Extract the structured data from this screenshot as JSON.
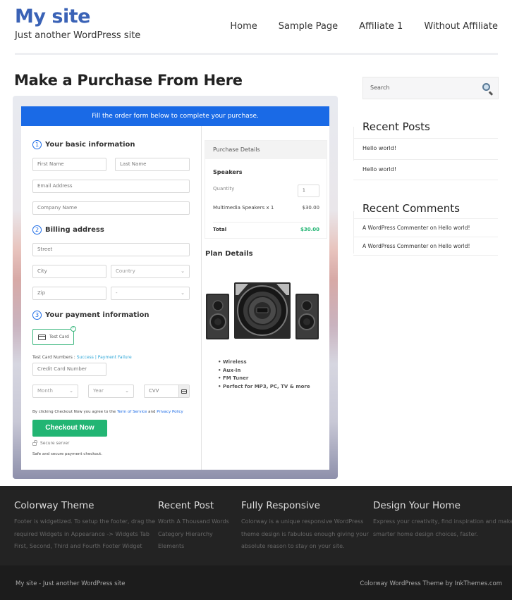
{
  "header": {
    "site_title": "My site",
    "tagline": "Just another WordPress site",
    "nav": [
      "Home",
      "Sample Page",
      "Affiliate 1",
      "Without Affiliate"
    ]
  },
  "page_title": "Make a Purchase From Here",
  "order_form": {
    "banner": "Fill the order form below to complete your purchase.",
    "step1": {
      "number": "1",
      "title": "Your basic information"
    },
    "first_name_placeholder": "First Name",
    "last_name_placeholder": "Last Name",
    "email_placeholder": "Email Address",
    "company_placeholder": "Company Name",
    "step2": {
      "number": "2",
      "title": "Billing address"
    },
    "street_placeholder": "Street",
    "city_placeholder": "City",
    "country_select": "Country",
    "zip_placeholder": "Zip",
    "state_select": "-",
    "step3": {
      "number": "3",
      "title": "Your payment information"
    },
    "payment_method": "Test Card",
    "test_numbers_label": "Test Card Numbers :",
    "test_success": "Success",
    "test_separator": "|",
    "test_failure": "Payment Failure",
    "card_number_placeholder": "Credit Card Number",
    "month_select": "Month",
    "year_select": "Year",
    "cvv_placeholder": "CVV",
    "agree_prefix": "By clicking Checkout Now you agree to the",
    "terms_link": "Term of Service",
    "agree_and": "and",
    "privacy_link": "Privacy Policy",
    "checkout_button": "Checkout Now",
    "secure_label": "Secure server",
    "safe_label": "Safe and secure payment checkout."
  },
  "purchase_details": {
    "heading": "Purchase Details",
    "product": "Speakers",
    "quantity_label": "Quantity",
    "quantity_value": "1",
    "line_item": "Multimedia Speakers x 1",
    "line_price": "$30.00",
    "total_label": "Total",
    "total_value": "$30.00",
    "accent_color": "#22b573"
  },
  "plan_details": {
    "heading": "Plan Details",
    "image": "speakers-image",
    "features": [
      "Wireless",
      "Aux-In",
      "FM Tuner",
      "Perfect for MP3, PC, TV & more"
    ]
  },
  "sidebar": {
    "search_placeholder": "Search",
    "recent_posts_heading": "Recent Posts",
    "recent_posts": [
      "Hello world!",
      "Hello world!"
    ],
    "recent_comments_heading": "Recent Comments",
    "recent_comments": [
      "A WordPress Commenter on Hello world!",
      "A WordPress Commenter on Hello world!"
    ]
  },
  "footer": {
    "columns": [
      {
        "title": "Colorway Theme",
        "lines": [
          "Footer is widgetized. To setup the footer, drag the",
          "required Widgets in Appearance -> Widgets Tab",
          "First, Second, Third and Fourth Footer Widget"
        ]
      },
      {
        "title": "Recent Post",
        "lines": [
          "Worth A Thousand Words",
          "Category Hierarchy",
          "Elements"
        ]
      },
      {
        "title": "Fully Responsive",
        "lines": [
          "Colorway is a unique responsive WordPress",
          "theme design is fabulous enough giving your",
          "absolute reason to stay on your site."
        ]
      },
      {
        "title": "Design Your Home",
        "lines": [
          "Express your creativity, find inspiration and make",
          "smarter home design choices, faster."
        ]
      }
    ],
    "bottom_left": "My site - Just another WordPress site",
    "bottom_right": "Colorway WordPress Theme by InkThemes.com"
  },
  "colors": {
    "brand_blue": "#3a62b6",
    "banner_blue": "#1a6ae6",
    "checkout_green": "#22b573"
  }
}
